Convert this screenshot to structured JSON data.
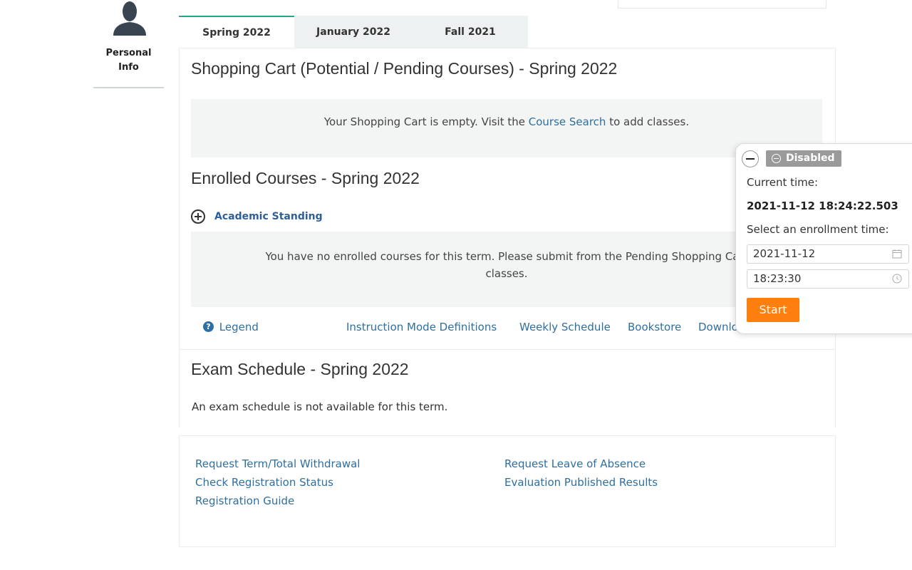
{
  "sidebar": {
    "personal_info_label": "Personal\nInfo"
  },
  "tabs": [
    {
      "label": "Spring 2022",
      "active": true
    },
    {
      "label": "January 2022",
      "active": false
    },
    {
      "label": "Fall 2021",
      "active": false
    }
  ],
  "shopping_cart": {
    "title": "Shopping Cart (Potential / Pending Courses) - Spring 2022",
    "empty_prefix": "Your Shopping Cart is empty. Visit the ",
    "course_search_link": "Course Search",
    "empty_suffix": " to add classes."
  },
  "enrolled": {
    "title": "Enrolled Courses - Spring 2022",
    "academic_standing": "Academic Standing",
    "empty_line1": "You have no enrolled courses for this term. Please submit from the Pending Shopping Cart",
    "empty_line2": "classes."
  },
  "links": {
    "legend": "Legend",
    "instruction_mode": "Instruction Mode Definitions",
    "weekly_schedule": "Weekly Schedule",
    "bookstore": "Bookstore",
    "download": "Downlo"
  },
  "exam": {
    "title": "Exam Schedule - Spring 2022",
    "text": "An exam schedule is not available for this term."
  },
  "footer_links": {
    "withdrawal": "Request Term/Total Withdrawal",
    "check_status": "Check Registration Status",
    "guide": "Registration Guide",
    "leave": "Request Leave of Absence",
    "evaluation": "Evaluation Published Results"
  },
  "popup": {
    "status": "Disabled",
    "current_time_label": "Current time:",
    "current_time": "2021-11-12 18:24:22.503",
    "select_label": "Select an enrollment time:",
    "date_value": "2021-11-12",
    "time_value": "18:23:30",
    "start_label": "Start"
  },
  "colors": {
    "accent_tab": "#2aa58a",
    "link": "#2f6f9f",
    "start_button": "#ff7f0e",
    "badge": "#9a9a9a"
  }
}
